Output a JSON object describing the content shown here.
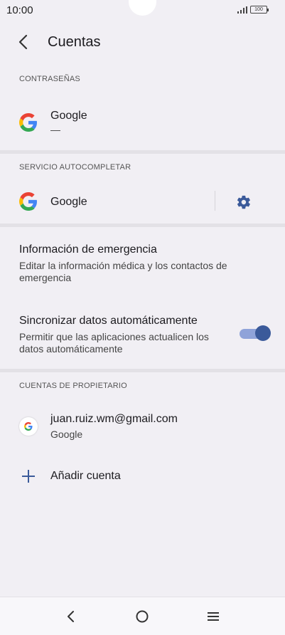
{
  "status_bar": {
    "time": "10:00",
    "battery": "100"
  },
  "header": {
    "title": "Cuentas"
  },
  "passwords_section": {
    "header": "CONTRASEÑAS",
    "item": {
      "title": "Google",
      "subtitle": "—"
    }
  },
  "autofill_section": {
    "header": "SERVICIO AUTOCOMPLETAR",
    "item": {
      "title": "Google"
    }
  },
  "emergency": {
    "title": "Información de emergencia",
    "subtitle_line1": "Editar la información médica y los contactos de",
    "subtitle_line2": "emergencia"
  },
  "sync": {
    "title": "Sincronizar datos automáticamente",
    "subtitle_line1": "Permitir que las aplicaciones actualicen los",
    "subtitle_line2": "datos automáticamente",
    "enabled": true
  },
  "owner_accounts": {
    "header": "CUENTAS DE PROPIETARIO",
    "account": {
      "email": "juan.ruiz.wm@gmail.com",
      "provider": "Google"
    },
    "add_label": "Añadir cuenta"
  },
  "colors": {
    "background": "#f1eff4",
    "accent": "#3b5a9a",
    "toggle_track": "#8fa3d9"
  },
  "icons": [
    "back-icon",
    "google-logo",
    "gear-icon",
    "plus-icon",
    "nav-back-icon",
    "nav-home-icon",
    "nav-menu-icon"
  ]
}
